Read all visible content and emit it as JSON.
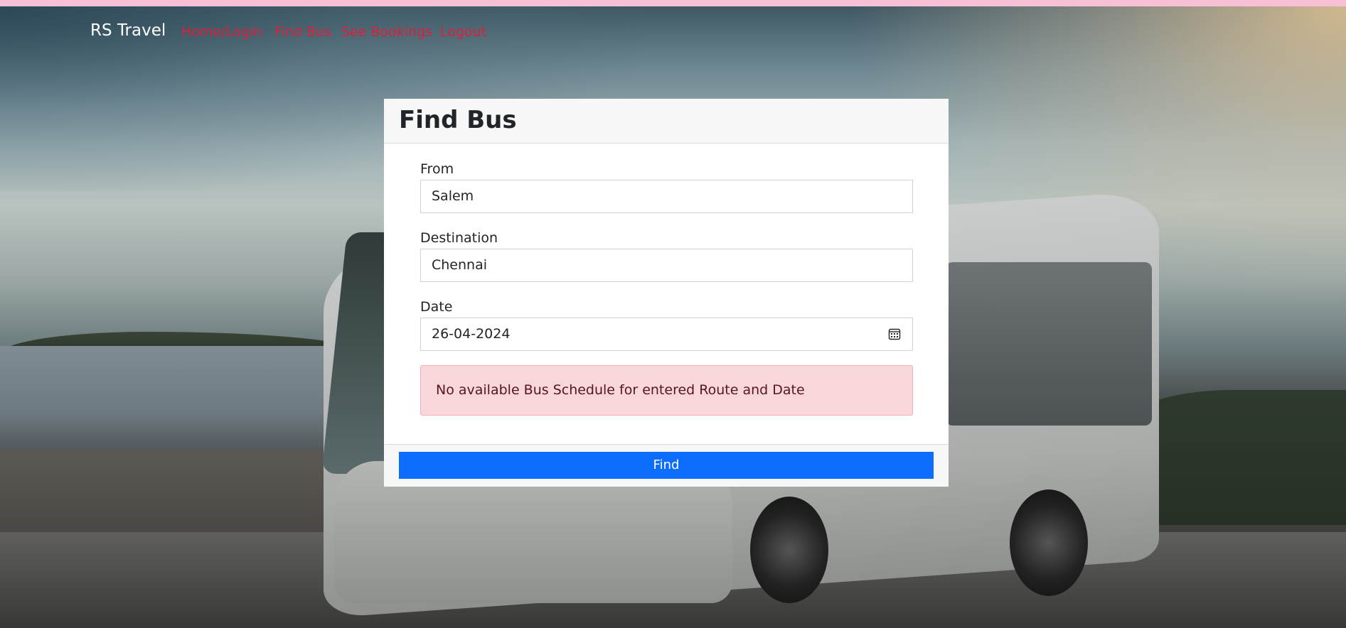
{
  "navbar": {
    "brand": "RS Travel",
    "links": [
      "Home/Login",
      "Find Bus",
      "See Bookings",
      "Logout"
    ]
  },
  "form": {
    "title": "Find Bus",
    "from_label": "From",
    "from_value": "Salem",
    "destination_label": "Destination",
    "destination_value": "Chennai",
    "date_label": "Date",
    "date_value": "26-04-2024",
    "alert": "No available Bus Schedule for entered Route and Date",
    "submit_label": "Find"
  },
  "colors": {
    "link": "#dc1f3c",
    "primary_button": "#0d6efd",
    "alert_background": "#f8d7da",
    "alert_text": "#58151c",
    "top_strip": "#f8c0d6"
  },
  "icons": {
    "date_picker": "calendar-icon"
  }
}
